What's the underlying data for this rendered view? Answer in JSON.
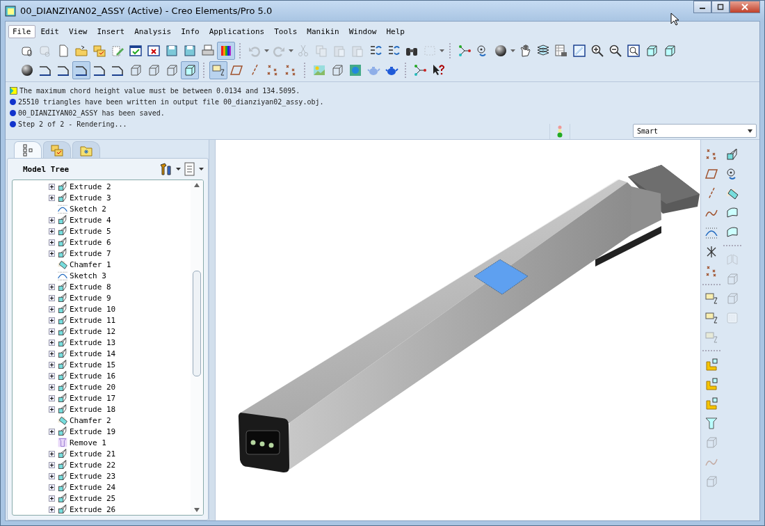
{
  "window": {
    "title": "00_DIANZIYAN02_ASSY (Active) - Creo Elements/Pro 5.0"
  },
  "menu": [
    {
      "label": "File",
      "selected": true
    },
    {
      "label": "Edit",
      "selected": false
    },
    {
      "label": "View",
      "selected": false
    },
    {
      "label": "Insert",
      "selected": false
    },
    {
      "label": "Analysis",
      "selected": false
    },
    {
      "label": "Info",
      "selected": false
    },
    {
      "label": "Applications",
      "selected": false
    },
    {
      "label": "Tools",
      "selected": false
    },
    {
      "label": "Manikin",
      "selected": false
    },
    {
      "label": "Window",
      "selected": false
    },
    {
      "label": "Help",
      "selected": false
    }
  ],
  "toolbars": [
    [
      [
        {
          "kind": "disk-clip",
          "pressed": false,
          "disabled": false
        },
        {
          "kind": "disk-link",
          "pressed": false,
          "disabled": true
        },
        {
          "kind": "page",
          "pressed": false,
          "disabled": false
        },
        {
          "kind": "folder",
          "pressed": false,
          "disabled": false
        },
        {
          "kind": "folders",
          "pressed": false,
          "disabled": false
        },
        {
          "kind": "pencil",
          "pressed": false,
          "disabled": false
        },
        {
          "kind": "confirm-window",
          "pressed": false,
          "disabled": false
        },
        {
          "kind": "window-x",
          "pressed": false,
          "disabled": false
        },
        {
          "kind": "floppy",
          "pressed": false,
          "disabled": false
        },
        {
          "kind": "floppy",
          "pressed": false,
          "disabled": false
        },
        {
          "kind": "printer",
          "pressed": false,
          "disabled": false
        },
        {
          "kind": "color-bars",
          "pressed": true,
          "disabled": false
        }
      ],
      [
        {
          "kind": "undo",
          "pressed": false,
          "disabled": true
        },
        {
          "kind": "redo",
          "pressed": false,
          "disabled": true
        },
        {
          "kind": "scissors",
          "pressed": false,
          "disabled": true
        },
        {
          "kind": "copy",
          "pressed": false,
          "disabled": true
        },
        {
          "kind": "paste",
          "pressed": false,
          "disabled": true
        },
        {
          "kind": "paste",
          "pressed": false,
          "disabled": true
        },
        {
          "kind": "list-arrows",
          "pressed": false,
          "disabled": false
        },
        {
          "kind": "list-arrows",
          "pressed": false,
          "disabled": false
        },
        {
          "kind": "binoculars",
          "pressed": false,
          "disabled": false
        },
        {
          "kind": "dashed-box",
          "pressed": false,
          "disabled": true
        }
      ],
      [
        {
          "kind": "nodes",
          "pressed": false,
          "disabled": false
        },
        {
          "kind": "spin",
          "pressed": false,
          "disabled": false
        },
        {
          "kind": "sphere",
          "pressed": false,
          "disabled": false
        },
        {
          "kind": "hand",
          "pressed": false,
          "disabled": false
        },
        {
          "kind": "layers",
          "pressed": false,
          "disabled": false
        },
        {
          "kind": "table",
          "pressed": false,
          "disabled": false
        },
        {
          "kind": "window-pattern",
          "pressed": false,
          "disabled": false
        },
        {
          "kind": "zoom-in",
          "pressed": false,
          "disabled": false
        },
        {
          "kind": "zoom-out",
          "pressed": false,
          "disabled": false
        },
        {
          "kind": "zoom-fit",
          "pressed": false,
          "disabled": false
        },
        {
          "kind": "cube",
          "pressed": false,
          "disabled": false
        },
        {
          "kind": "cube",
          "pressed": false,
          "disabled": false
        }
      ]
    ],
    [
      [
        {
          "kind": "sphere",
          "pressed": false,
          "disabled": false
        },
        {
          "kind": "edge",
          "pressed": false,
          "disabled": false
        },
        {
          "kind": "edge",
          "pressed": false,
          "disabled": false
        },
        {
          "kind": "edge",
          "pressed": true,
          "disabled": false
        },
        {
          "kind": "edge",
          "pressed": false,
          "disabled": false
        },
        {
          "kind": "edge",
          "pressed": false,
          "disabled": false
        },
        {
          "kind": "wire-cube",
          "pressed": false,
          "disabled": false
        },
        {
          "kind": "wire-cube",
          "pressed": false,
          "disabled": false
        },
        {
          "kind": "wire-cube",
          "pressed": false,
          "disabled": false
        },
        {
          "kind": "cube",
          "pressed": true,
          "disabled": false
        }
      ],
      [
        {
          "kind": "plane-tag",
          "pressed": true,
          "disabled": false
        },
        {
          "kind": "plane",
          "pressed": false,
          "disabled": false
        },
        {
          "kind": "axis",
          "pressed": false,
          "disabled": false
        },
        {
          "kind": "points",
          "pressed": false,
          "disabled": false
        },
        {
          "kind": "points",
          "pressed": false,
          "disabled": false
        }
      ],
      [
        {
          "kind": "landscape",
          "pressed": false,
          "disabled": false
        },
        {
          "kind": "wire-cube",
          "pressed": false,
          "disabled": false
        },
        {
          "kind": "globe",
          "pressed": false,
          "disabled": false
        },
        {
          "kind": "teapot",
          "pressed": false,
          "disabled": true
        },
        {
          "kind": "teapot",
          "pressed": false,
          "disabled": false
        }
      ],
      [
        {
          "kind": "nodes",
          "pressed": false,
          "disabled": false
        },
        {
          "kind": "pointer-question",
          "pressed": false,
          "disabled": false
        }
      ]
    ]
  ],
  "messages": [
    {
      "kind": "prompt",
      "text": "The maximum chord height value must be between 0.0134 and 134.5095."
    },
    {
      "kind": "info",
      "text": "25510 triangles have been written in output file 00_dianziyan02_assy.obj."
    },
    {
      "kind": "info",
      "text": "00_DIANZIYAN02_ASSY has been saved."
    },
    {
      "kind": "info",
      "text": "Step 2 of 2 - Rendering..."
    }
  ],
  "filter": {
    "value": "Smart"
  },
  "panel_tabs": [
    {
      "kind": "tree",
      "selected": true
    },
    {
      "kind": "folders",
      "selected": false
    },
    {
      "kind": "favorites",
      "selected": false
    }
  ],
  "model_tree": {
    "title": "Model Tree",
    "items": [
      {
        "kind": "extrude",
        "label": "Extrude 2",
        "expander": true
      },
      {
        "kind": "extrude",
        "label": "Extrude 3",
        "expander": true
      },
      {
        "kind": "sketch",
        "label": "Sketch 2",
        "expander": false
      },
      {
        "kind": "extrude",
        "label": "Extrude 4",
        "expander": true
      },
      {
        "kind": "extrude",
        "label": "Extrude 5",
        "expander": true
      },
      {
        "kind": "extrude",
        "label": "Extrude 6",
        "expander": true
      },
      {
        "kind": "extrude",
        "label": "Extrude 7",
        "expander": true
      },
      {
        "kind": "chamfer",
        "label": "Chamfer 1",
        "expander": false
      },
      {
        "kind": "sketch",
        "label": "Sketch 3",
        "expander": false
      },
      {
        "kind": "extrude",
        "label": "Extrude 8",
        "expander": true
      },
      {
        "kind": "extrude",
        "label": "Extrude 9",
        "expander": true
      },
      {
        "kind": "extrude",
        "label": "Extrude 10",
        "expander": true
      },
      {
        "kind": "extrude",
        "label": "Extrude 11",
        "expander": true
      },
      {
        "kind": "extrude",
        "label": "Extrude 12",
        "expander": true
      },
      {
        "kind": "extrude",
        "label": "Extrude 13",
        "expander": true
      },
      {
        "kind": "extrude",
        "label": "Extrude 14",
        "expander": true
      },
      {
        "kind": "extrude",
        "label": "Extrude 15",
        "expander": true
      },
      {
        "kind": "extrude",
        "label": "Extrude 16",
        "expander": true
      },
      {
        "kind": "extrude",
        "label": "Extrude 20",
        "expander": true
      },
      {
        "kind": "extrude",
        "label": "Extrude 17",
        "expander": true
      },
      {
        "kind": "extrude",
        "label": "Extrude 18",
        "expander": true
      },
      {
        "kind": "chamfer",
        "label": "Chamfer 2",
        "expander": false
      },
      {
        "kind": "extrude",
        "label": "Extrude 19",
        "expander": true
      },
      {
        "kind": "remove",
        "label": "Remove 1",
        "expander": false
      },
      {
        "kind": "extrude",
        "label": "Extrude 21",
        "expander": true
      },
      {
        "kind": "extrude",
        "label": "Extrude 22",
        "expander": true
      },
      {
        "kind": "extrude",
        "label": "Extrude 23",
        "expander": true
      },
      {
        "kind": "extrude",
        "label": "Extrude 24",
        "expander": true
      },
      {
        "kind": "extrude",
        "label": "Extrude 25",
        "expander": true
      },
      {
        "kind": "extrude",
        "label": "Extrude 26",
        "expander": true
      }
    ]
  },
  "right_toolbar": {
    "left": [
      [
        {
          "kind": "points",
          "disabled": false
        },
        {
          "kind": "plane",
          "disabled": false
        },
        {
          "kind": "axis",
          "disabled": false
        },
        {
          "kind": "curve",
          "disabled": false
        },
        {
          "kind": "sketch",
          "disabled": false
        },
        {
          "kind": "csys",
          "disabled": false
        },
        {
          "kind": "points",
          "disabled": false
        }
      ],
      [
        {
          "kind": "plane-tag",
          "disabled": false
        },
        {
          "kind": "plane-tag",
          "disabled": false
        },
        {
          "kind": "plane-tag",
          "disabled": true
        }
      ],
      [
        {
          "kind": "bracket",
          "disabled": false
        },
        {
          "kind": "bracket",
          "disabled": false
        },
        {
          "kind": "bracket",
          "disabled": false
        },
        {
          "kind": "funnel",
          "disabled": false
        },
        {
          "kind": "wire-cube",
          "disabled": true
        },
        {
          "kind": "curve",
          "disabled": true
        },
        {
          "kind": "wire-cube",
          "disabled": true
        }
      ]
    ],
    "right": [
      [
        {
          "kind": "extrude",
          "disabled": false
        },
        {
          "kind": "spin",
          "disabled": false
        },
        {
          "kind": "chamfer",
          "disabled": false
        },
        {
          "kind": "surface",
          "disabled": false
        },
        {
          "kind": "surface",
          "disabled": false
        }
      ],
      [
        {
          "kind": "mirror",
          "disabled": true
        },
        {
          "kind": "wire-cube",
          "disabled": true
        },
        {
          "kind": "wire-cube",
          "disabled": true
        },
        {
          "kind": "grid",
          "disabled": true
        }
      ]
    ]
  }
}
